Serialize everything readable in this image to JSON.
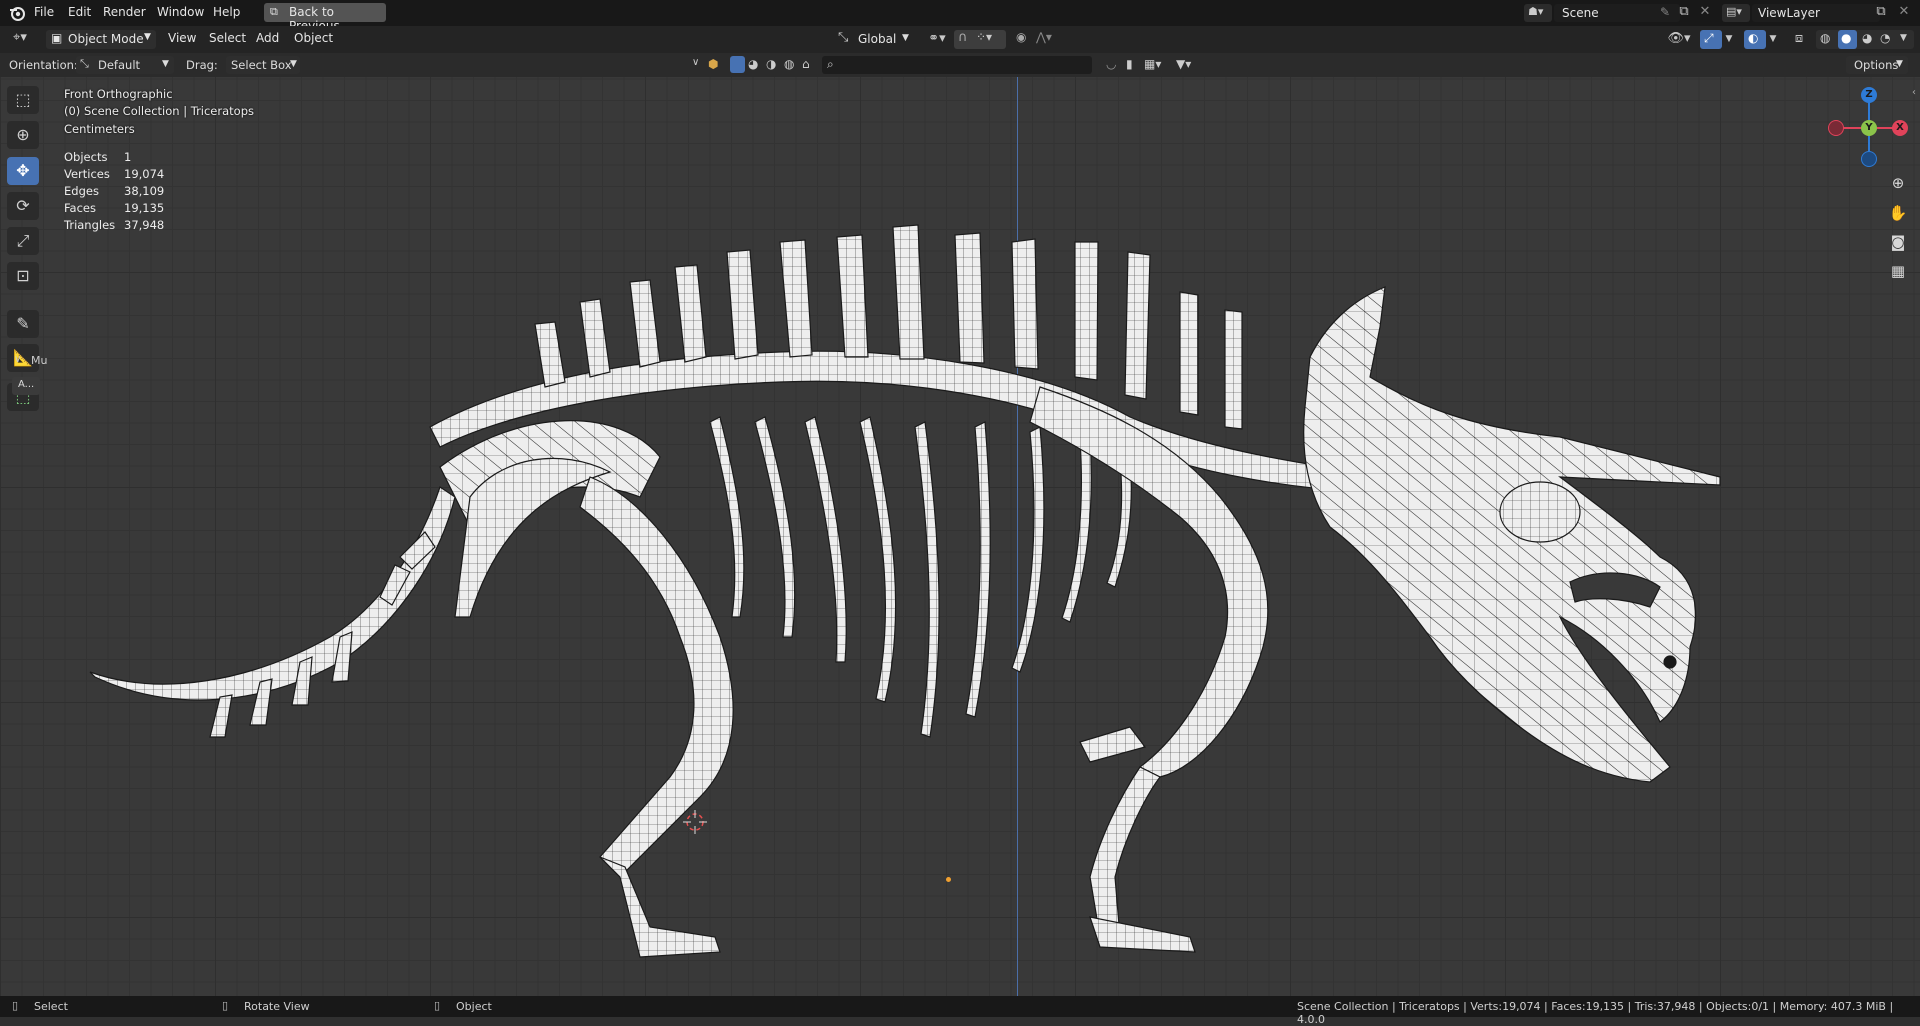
{
  "topbar": {
    "menus": [
      "File",
      "Edit",
      "Render",
      "Window",
      "Help"
    ],
    "back_button": "Back to Previous",
    "scene_name": "Scene",
    "view_layer": "ViewLayer"
  },
  "header": {
    "mode": "Object Mode",
    "menus": [
      "View",
      "Select",
      "Add",
      "Object"
    ],
    "transform_orientation": "Global"
  },
  "tool_settings": {
    "orientation_label": "Orientation:",
    "orientation_value": "Default",
    "drag_label": "Drag:",
    "drag_value": "Select Box",
    "options_label": "Options"
  },
  "viewport_overlay": {
    "view_name": "Front Orthographic",
    "collection": "(0) Scene Collection | Triceratops",
    "units": "Centimeters",
    "stats": [
      {
        "label": "Objects",
        "value": "1"
      },
      {
        "label": "Vertices",
        "value": "19,074"
      },
      {
        "label": "Edges",
        "value": "38,109"
      },
      {
        "label": "Faces",
        "value": "19,135"
      },
      {
        "label": "Triangles",
        "value": "37,948"
      }
    ]
  },
  "left_panel": {
    "collapsed_label": "Mu",
    "small_button": "A..."
  },
  "gizmo": {
    "z_label": "Z",
    "y_label": "Y",
    "x_label": "X",
    "z_color": "#2e7bd6",
    "y_color": "#8bc34a",
    "x_color": "#e0435a"
  },
  "statusbar": {
    "select": "Select",
    "rotate_view": "Rotate View",
    "object": "Object",
    "info": "Scene Collection | Triceratops | Verts:19,074 | Faces:19,135 | Tris:37,948 | Objects:0/1 | Memory: 407.3 MiB | 4.0.0"
  },
  "icons": [
    "blender-logo-icon",
    "editor-type-icon",
    "object-mode-icon",
    "transform-orientation-icon",
    "pivot-icon",
    "snap-icon",
    "proportional-edit-icon",
    "visibility-icon",
    "gizmo-icon",
    "overlay-icon",
    "xray-icon",
    "shading-icon",
    "zoom-icon",
    "pan-icon",
    "camera-icon",
    "grid-icon",
    "select-box-icon",
    "cursor-icon",
    "move-icon",
    "rotate-icon",
    "scale-icon",
    "transform-icon",
    "annotate-icon",
    "measure-icon",
    "add-cube-icon",
    "search-icon",
    "filter-icon"
  ]
}
